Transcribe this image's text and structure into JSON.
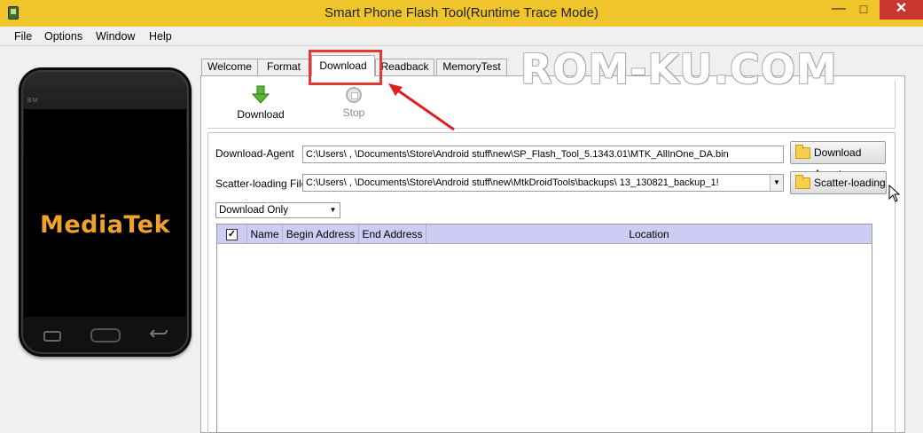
{
  "window": {
    "title": "Smart Phone Flash Tool(Runtime Trace Mode)",
    "minimize": "—",
    "maximize": "□",
    "close": "✕"
  },
  "menu": [
    "File",
    "Options",
    "Window",
    "Help"
  ],
  "phone": {
    "brand": "BM",
    "screen_label": "MediaTek"
  },
  "tabs": [
    "Welcome",
    "Format",
    "Download",
    "Readback",
    "MemoryTest"
  ],
  "active_tab": "Download",
  "watermark": "ROM-KU.COM",
  "toolbar": {
    "download_label": "Download",
    "stop_label": "Stop"
  },
  "form": {
    "download_agent_label": "Download-Agent",
    "download_agent_value": "C:\\Users\\ ,   \\Documents\\Store\\Android stuff\\new\\SP_Flash_Tool_5.1343.01\\MTK_AllInOne_DA.bin",
    "download_agent_button": "Download Agent",
    "scatter_label": "Scatter-loading File",
    "scatter_value": "C:\\Users\\   ,  \\Documents\\Store\\Android stuff\\new\\MtkDroidTools\\backups\\         13_130821_backup_1!",
    "scatter_button": "Scatter-loading",
    "mode_value": "Download Only"
  },
  "table": {
    "check_mark": "✓",
    "columns": [
      "Name",
      "Begin Address",
      "End Address",
      "Location"
    ]
  },
  "colors": {
    "titlebar": "#f0c52c",
    "table_header": "#ccccf4",
    "highlight": "#e53935",
    "phone_label": "#f0a030"
  }
}
